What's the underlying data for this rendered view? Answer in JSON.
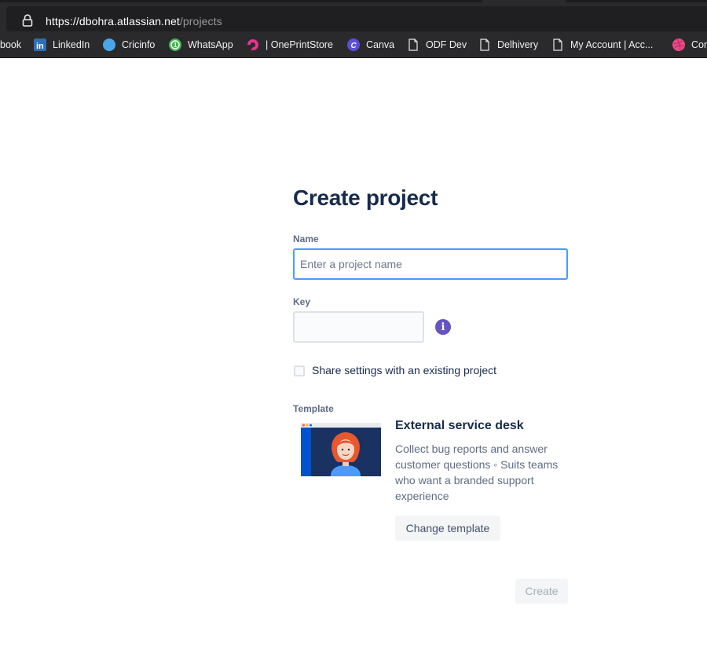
{
  "browser": {
    "url_main": "https://dbohra.atlassian.net",
    "url_path": "/projects",
    "bookmarks": [
      {
        "label": "book",
        "icon": "facebook-icon"
      },
      {
        "label": "LinkedIn",
        "icon": "linkedin-icon"
      },
      {
        "label": "Cricinfo",
        "icon": "cricinfo-icon"
      },
      {
        "label": "WhatsApp",
        "icon": "whatsapp-icon"
      },
      {
        "label": "| OnePrintStore",
        "icon": "oneprintstore-icon"
      },
      {
        "label": "Canva",
        "icon": "canva-icon"
      },
      {
        "label": "ODF Dev",
        "icon": "page-icon"
      },
      {
        "label": "Delhivery",
        "icon": "page-icon"
      },
      {
        "label": "My Account | Acc...",
        "icon": "page-icon"
      },
      {
        "label": "Cor",
        "icon": "dribbble-icon"
      }
    ]
  },
  "form": {
    "title": "Create project",
    "name_label": "Name",
    "name_placeholder": "Enter a project name",
    "name_value": "",
    "key_label": "Key",
    "key_value": "",
    "info_glyph": "i",
    "share_label": "Share settings with an existing project",
    "share_checked": false,
    "template_label": "Template",
    "template_title": "External service desk",
    "template_description": "Collect bug reports and answer customer questions ◦ Suits teams who want a branded support experience",
    "change_template_label": "Change template",
    "create_label": "Create"
  },
  "colors": {
    "heading": "#172b4d",
    "label": "#5e6c84",
    "focus_border": "#4c9aff",
    "info_purple": "#6554c0",
    "browser_bg": "#2a2a2c"
  }
}
